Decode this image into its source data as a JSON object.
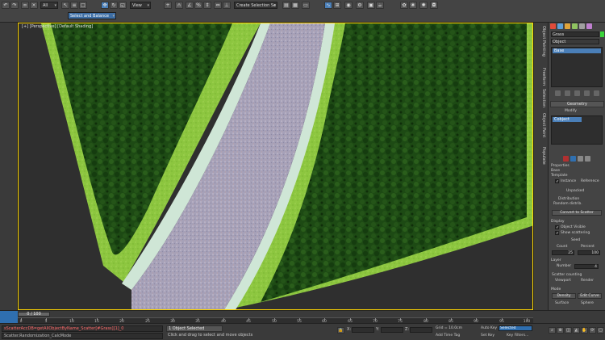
{
  "toolbar": {
    "selection_filter": "All",
    "named_selection": "Select",
    "view_dropdown": "View",
    "selection_set": "Create Selection Se",
    "object_dropdown": "Select and Balance"
  },
  "viewport": {
    "label": "[+] [Perspective] [Default Shading]"
  },
  "side_tabs": [
    "Object Painting",
    "Freeform",
    "Selection",
    "Object Paint",
    "Populate"
  ],
  "command_panel": {
    "name_field": "Grass",
    "object_label": "Object",
    "selected_item": "Cobject",
    "rollout_geometry": "Geometry",
    "rollout_modify": "Modify",
    "label_properties": "Properties",
    "label_base": "Base",
    "label_template": "Template",
    "btn_instance": "Instance",
    "btn_source": "Reference",
    "label_unpacked": "Unpacked",
    "label_distribution": "Distribution",
    "label_random_dist": "Random distrib.",
    "label_convert": "Convert to Scatter",
    "label_display": "Display",
    "chk_object_visible": "Object Visible",
    "chk_show_scattering": "Show scattering",
    "label_seed": "Seed",
    "label_count": "Count",
    "label_percent": "Percent",
    "val_count": "25",
    "val_percent": "100",
    "label_layer": "Layer",
    "label_number": "Number",
    "val_number": "4",
    "label_scatter_counting": "Scatter counting",
    "label_viewport": "Viewport",
    "label_render": "Render",
    "label_mode": "Mode",
    "val_mode": "Edit",
    "btn_density": "Density",
    "btn_edit_curve": "Edit Curve",
    "label_surface": "Surface",
    "label_sphere": "Sphere"
  },
  "timeline": {
    "slider": "0 / 100",
    "ticks": [
      "0",
      "5",
      "10",
      "15",
      "20",
      "25",
      "30",
      "35",
      "40",
      "45",
      "50",
      "55",
      "60",
      "65",
      "70",
      "75",
      "80",
      "85",
      "90",
      "95",
      "100"
    ]
  },
  "status": {
    "maxscript_line1": "sScatterAccDB=getAllObjectByName_Scatter[#Grass][1]_0",
    "maxscript_line2": "Scatter.Randomization_CalcMode",
    "selected": "1 Object Selected",
    "prompt": "Click and drag to select and move objects",
    "x_label": "X:",
    "y_label": "Y:",
    "z_label": "Z:",
    "x_val": "",
    "y_val": "",
    "z_val": "",
    "grid": "Grid = 10.0cm",
    "add_time_tag": "Add Time Tag",
    "auto_key": "Auto Key",
    "selected_dropdown": "Selected",
    "set_key": "Set Key",
    "key_filters": "Key Filters..."
  }
}
